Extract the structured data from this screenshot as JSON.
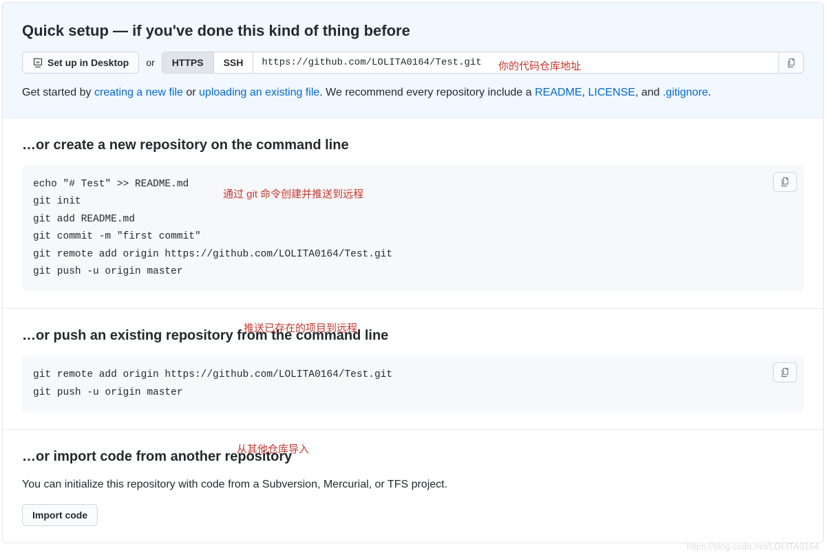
{
  "quickSetup": {
    "title": "Quick setup — if you've done this kind of thing before",
    "setupDesktopLabel": "Set up in Desktop",
    "orText": "or",
    "protocols": {
      "https": "HTTPS",
      "ssh": "SSH"
    },
    "repoUrl": "https://github.com/LOLITA0164/Test.git",
    "annotation": "你的代码仓库地址",
    "getStarted": {
      "prefix": "Get started by ",
      "createFile": "creating a new file",
      "or": " or ",
      "uploadFile": "uploading an existing file",
      "mid": ". We recommend every repository include a ",
      "readme": "README",
      "comma1": ", ",
      "license": "LICENSE",
      "comma2": ", and ",
      "gitignore": ".gitignore",
      "suffix": "."
    }
  },
  "createRepo": {
    "title": "…or create a new repository on the command line",
    "code": "echo \"# Test\" >> README.md\ngit init\ngit add README.md\ngit commit -m \"first commit\"\ngit remote add origin https://github.com/LOLITA0164/Test.git\ngit push -u origin master",
    "annotation": "通过 git 命令创建并推送到远程"
  },
  "pushExisting": {
    "title": "…or push an existing repository from the command line",
    "code": "git remote add origin https://github.com/LOLITA0164/Test.git\ngit push -u origin master",
    "annotation": "推送已存在的项目到远程"
  },
  "importCode": {
    "title": "…or import code from another repository",
    "description": "You can initialize this repository with code from a Subversion, Mercurial, or TFS project.",
    "buttonLabel": "Import code",
    "annotation": "从其他仓库导入"
  },
  "watermark": "https://blog.csdn.net/LOLITA0164"
}
